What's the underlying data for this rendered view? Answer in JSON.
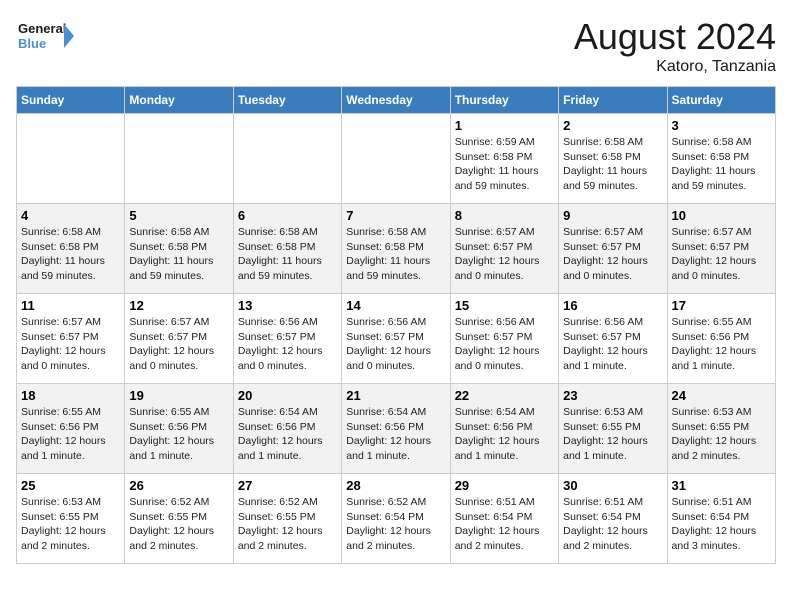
{
  "header": {
    "logo_line1": "General",
    "logo_line2": "Blue",
    "month_year": "August 2024",
    "location": "Katoro, Tanzania"
  },
  "weekdays": [
    "Sunday",
    "Monday",
    "Tuesday",
    "Wednesday",
    "Thursday",
    "Friday",
    "Saturday"
  ],
  "weeks": [
    [
      {
        "day": "",
        "info": ""
      },
      {
        "day": "",
        "info": ""
      },
      {
        "day": "",
        "info": ""
      },
      {
        "day": "",
        "info": ""
      },
      {
        "day": "1",
        "info": "Sunrise: 6:59 AM\nSunset: 6:58 PM\nDaylight: 11 hours\nand 59 minutes."
      },
      {
        "day": "2",
        "info": "Sunrise: 6:58 AM\nSunset: 6:58 PM\nDaylight: 11 hours\nand 59 minutes."
      },
      {
        "day": "3",
        "info": "Sunrise: 6:58 AM\nSunset: 6:58 PM\nDaylight: 11 hours\nand 59 minutes."
      }
    ],
    [
      {
        "day": "4",
        "info": "Sunrise: 6:58 AM\nSunset: 6:58 PM\nDaylight: 11 hours\nand 59 minutes."
      },
      {
        "day": "5",
        "info": "Sunrise: 6:58 AM\nSunset: 6:58 PM\nDaylight: 11 hours\nand 59 minutes."
      },
      {
        "day": "6",
        "info": "Sunrise: 6:58 AM\nSunset: 6:58 PM\nDaylight: 11 hours\nand 59 minutes."
      },
      {
        "day": "7",
        "info": "Sunrise: 6:58 AM\nSunset: 6:58 PM\nDaylight: 11 hours\nand 59 minutes."
      },
      {
        "day": "8",
        "info": "Sunrise: 6:57 AM\nSunset: 6:57 PM\nDaylight: 12 hours\nand 0 minutes."
      },
      {
        "day": "9",
        "info": "Sunrise: 6:57 AM\nSunset: 6:57 PM\nDaylight: 12 hours\nand 0 minutes."
      },
      {
        "day": "10",
        "info": "Sunrise: 6:57 AM\nSunset: 6:57 PM\nDaylight: 12 hours\nand 0 minutes."
      }
    ],
    [
      {
        "day": "11",
        "info": "Sunrise: 6:57 AM\nSunset: 6:57 PM\nDaylight: 12 hours\nand 0 minutes."
      },
      {
        "day": "12",
        "info": "Sunrise: 6:57 AM\nSunset: 6:57 PM\nDaylight: 12 hours\nand 0 minutes."
      },
      {
        "day": "13",
        "info": "Sunrise: 6:56 AM\nSunset: 6:57 PM\nDaylight: 12 hours\nand 0 minutes."
      },
      {
        "day": "14",
        "info": "Sunrise: 6:56 AM\nSunset: 6:57 PM\nDaylight: 12 hours\nand 0 minutes."
      },
      {
        "day": "15",
        "info": "Sunrise: 6:56 AM\nSunset: 6:57 PM\nDaylight: 12 hours\nand 0 minutes."
      },
      {
        "day": "16",
        "info": "Sunrise: 6:56 AM\nSunset: 6:57 PM\nDaylight: 12 hours\nand 1 minute."
      },
      {
        "day": "17",
        "info": "Sunrise: 6:55 AM\nSunset: 6:56 PM\nDaylight: 12 hours\nand 1 minute."
      }
    ],
    [
      {
        "day": "18",
        "info": "Sunrise: 6:55 AM\nSunset: 6:56 PM\nDaylight: 12 hours\nand 1 minute."
      },
      {
        "day": "19",
        "info": "Sunrise: 6:55 AM\nSunset: 6:56 PM\nDaylight: 12 hours\nand 1 minute."
      },
      {
        "day": "20",
        "info": "Sunrise: 6:54 AM\nSunset: 6:56 PM\nDaylight: 12 hours\nand 1 minute."
      },
      {
        "day": "21",
        "info": "Sunrise: 6:54 AM\nSunset: 6:56 PM\nDaylight: 12 hours\nand 1 minute."
      },
      {
        "day": "22",
        "info": "Sunrise: 6:54 AM\nSunset: 6:56 PM\nDaylight: 12 hours\nand 1 minute."
      },
      {
        "day": "23",
        "info": "Sunrise: 6:53 AM\nSunset: 6:55 PM\nDaylight: 12 hours\nand 1 minute."
      },
      {
        "day": "24",
        "info": "Sunrise: 6:53 AM\nSunset: 6:55 PM\nDaylight: 12 hours\nand 2 minutes."
      }
    ],
    [
      {
        "day": "25",
        "info": "Sunrise: 6:53 AM\nSunset: 6:55 PM\nDaylight: 12 hours\nand 2 minutes."
      },
      {
        "day": "26",
        "info": "Sunrise: 6:52 AM\nSunset: 6:55 PM\nDaylight: 12 hours\nand 2 minutes."
      },
      {
        "day": "27",
        "info": "Sunrise: 6:52 AM\nSunset: 6:55 PM\nDaylight: 12 hours\nand 2 minutes."
      },
      {
        "day": "28",
        "info": "Sunrise: 6:52 AM\nSunset: 6:54 PM\nDaylight: 12 hours\nand 2 minutes."
      },
      {
        "day": "29",
        "info": "Sunrise: 6:51 AM\nSunset: 6:54 PM\nDaylight: 12 hours\nand 2 minutes."
      },
      {
        "day": "30",
        "info": "Sunrise: 6:51 AM\nSunset: 6:54 PM\nDaylight: 12 hours\nand 2 minutes."
      },
      {
        "day": "31",
        "info": "Sunrise: 6:51 AM\nSunset: 6:54 PM\nDaylight: 12 hours\nand 3 minutes."
      }
    ]
  ]
}
